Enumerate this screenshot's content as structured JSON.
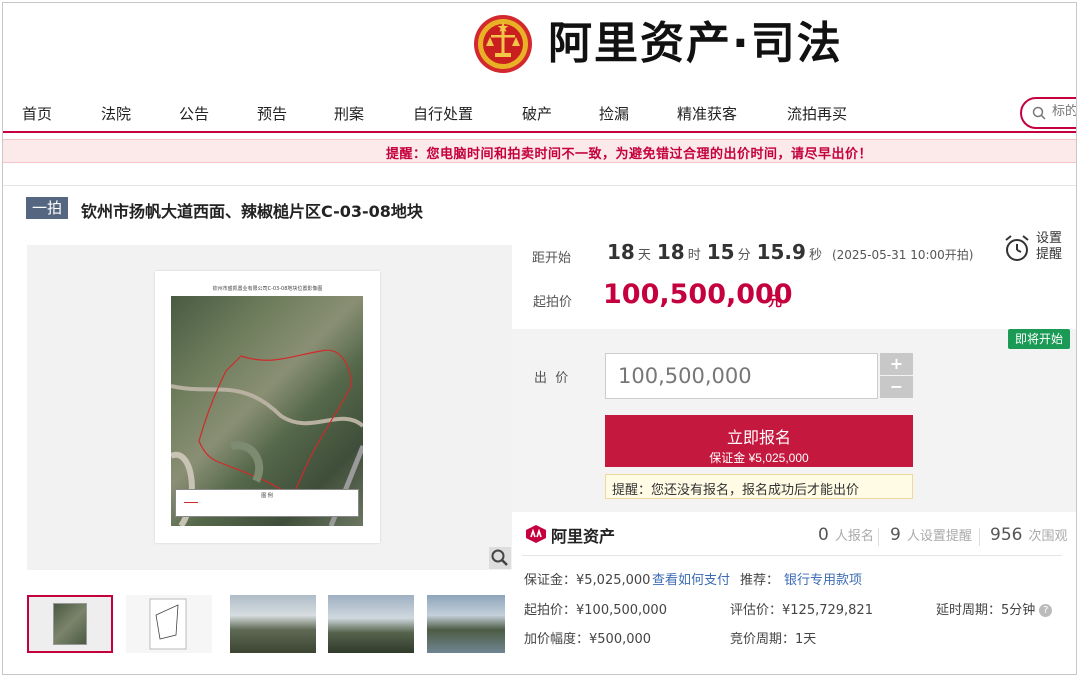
{
  "header": {
    "brand": "阿里资产·司法"
  },
  "nav": {
    "items": [
      "首页",
      "法院",
      "公告",
      "预告",
      "刑案",
      "自行处置",
      "破产",
      "捡漏",
      "精准获客",
      "流拍再买"
    ],
    "search_placeholder": "标的物"
  },
  "notice": "提醒：您电脑时间和拍卖时间不一致，为避免错过合理的出价时间，请尽早出价！",
  "item": {
    "badge": "一拍",
    "title": "钦州市扬帆大道西面、辣椒槌片区C-03-08地块"
  },
  "gallery": {
    "map_caption": "钦州市盛凯置业有限公司C-03-08地块位置影像图",
    "legend_title": "图 例"
  },
  "countdown": {
    "label": "距开始",
    "days": "18",
    "days_unit": "天",
    "hours": "18",
    "hours_unit": "时",
    "minutes": "15",
    "minutes_unit": "分",
    "seconds": "15.9",
    "seconds_unit": "秒",
    "start_time": "(2025-05-31 10:00开拍)"
  },
  "reminder": {
    "line1": "设置",
    "line2": "提醒"
  },
  "starting_price": {
    "label": "起拍价",
    "value": "100,500,000",
    "unit": "元"
  },
  "bid": {
    "status": "即将开始",
    "label": "出  价",
    "amount": "100,500,000",
    "plus": "+",
    "minus": "−",
    "signup_label": "立即报名",
    "deposit": "保证金 ¥5,025,000",
    "tip": "提醒：您还没有报名，报名成功后才能出价"
  },
  "platform": {
    "name": "阿里资产",
    "signups": "0",
    "signups_label": "人报名",
    "reminders": "9",
    "reminders_label": "人设置提醒",
    "views": "956",
    "views_label": "次围观"
  },
  "details": {
    "deposit": "保证金：¥5,025,000",
    "how_to_pay": "查看如何支付",
    "recommend_label": "推荐：",
    "recommend_link": "银行专用款项",
    "start_price": "起拍价：¥100,500,000",
    "eval_price": "评估价：¥125,729,821",
    "delay_period": "延时周期：5分钟",
    "increment": "加价幅度：¥500,000",
    "bid_period": "竞价周期：1天"
  },
  "colors": {
    "accent": "#c5003e",
    "status_green": "#1a9a54",
    "link": "#3c6bb4"
  }
}
